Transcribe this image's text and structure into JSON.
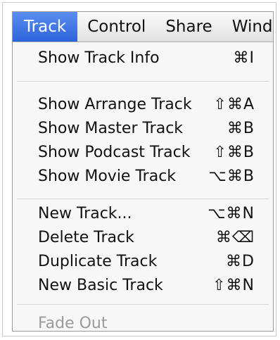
{
  "menubar": {
    "items": [
      {
        "label": "Track"
      },
      {
        "label": "Control"
      },
      {
        "label": "Share"
      },
      {
        "label": "Windo"
      }
    ]
  },
  "menu": {
    "groups": [
      [
        {
          "label": "Show Track Info",
          "shortcut": "⌘I"
        }
      ],
      [
        {
          "label": "Show Arrange Track",
          "shortcut": "⇧⌘A"
        },
        {
          "label": "Show Master Track",
          "shortcut": "⌘B"
        },
        {
          "label": "Show Podcast Track",
          "shortcut": "⇧⌘B"
        },
        {
          "label": "Show Movie Track",
          "shortcut": "⌥⌘B"
        }
      ],
      [
        {
          "label": "New Track...",
          "shortcut": "⌥⌘N"
        },
        {
          "label": "Delete Track",
          "shortcut": "⌘⌫"
        },
        {
          "label": "Duplicate Track",
          "shortcut": "⌘D"
        },
        {
          "label": "New Basic Track",
          "shortcut": "⇧⌘N"
        }
      ],
      [
        {
          "label": "Fade Out",
          "shortcut": "",
          "disabled": true
        }
      ]
    ]
  }
}
